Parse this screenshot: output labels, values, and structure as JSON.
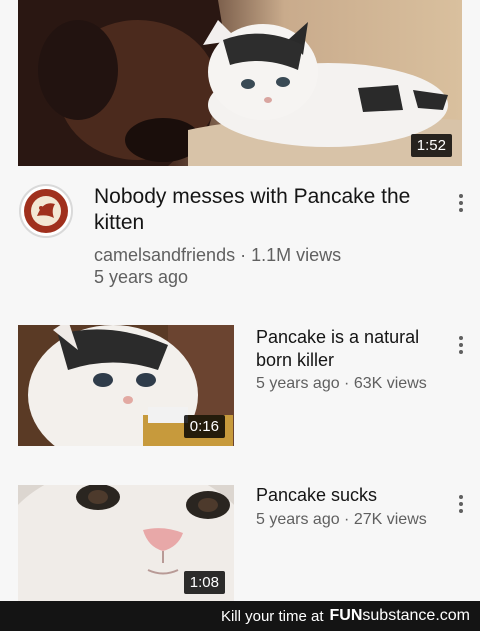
{
  "main_video": {
    "duration": "1:52",
    "title": "Nobody messes with Pancake the kitten",
    "channel": "camelsandfriends",
    "views": "1.1M views",
    "age": "5 years ago"
  },
  "related": [
    {
      "title": "Pancake is a natural born killer",
      "age": "5 years ago",
      "views": "63K views",
      "duration": "0:16"
    },
    {
      "title": "Pancake sucks",
      "age": "5 years ago",
      "views": "27K views",
      "duration": "1:08"
    }
  ],
  "meta_separator": " · ",
  "watermark": {
    "prefix": "Kill your time at",
    "brand_bold": "FUN",
    "brand_rest": "substance.com"
  },
  "icons": [
    "more-vert-icon",
    "channel-avatar"
  ],
  "colors": {
    "title": "#151515",
    "meta": "#606060",
    "duration_bg": "#000000"
  }
}
